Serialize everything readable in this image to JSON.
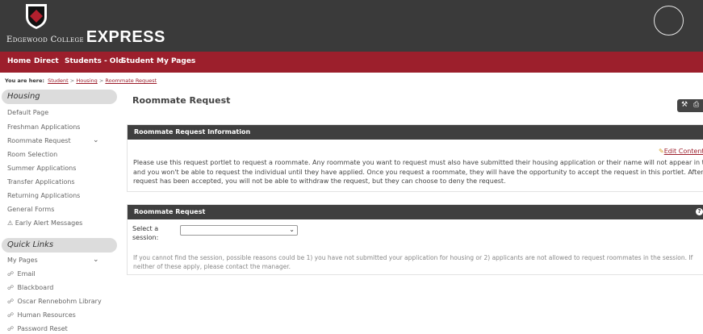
{
  "header": {
    "brand_small": "Edgewood College",
    "brand_big": "EXPRESS",
    "colors": {
      "top": "#3a3a3a",
      "nav": "#9c1f2c",
      "accent_text": "#9c1f2c"
    }
  },
  "nav": {
    "items": [
      "Home",
      "Direct",
      "Students - Old",
      "Student",
      "My Pages"
    ]
  },
  "breadcrumb": {
    "label": "You are here:",
    "items": [
      "Student",
      "Housing",
      "Roommate Request"
    ],
    "separator": ">"
  },
  "sidebar": {
    "section_title": "Housing",
    "items": [
      "Default Page",
      "Freshman Applications",
      "Roommate Request",
      "Room Selection",
      "Summer Applications",
      "Transfer Applications",
      "Returning Applications",
      "General Forms",
      "Early Alert Messages"
    ],
    "quick_links_title": "Quick Links",
    "my_pages_label": "My Pages",
    "links": [
      "Email",
      "Blackboard",
      "Oscar Rennebohm Library",
      "Human Resources",
      "Password Reset"
    ]
  },
  "main": {
    "title": "Roommate Request",
    "info_panel": {
      "title": "Roommate Request Information",
      "edit_label": "Edit Content",
      "lines": [
        "Please use this request portlet to request a roommate.  Any roommate you want to request must also have submitted their housing application or their name will not appear in the search",
        "and you won't be able to request the individual until they have applied.  Once you request a roommate, they will have the opportunity to accept the request in this portlet.  After your",
        "request has been accepted, you will not be able to withdraw the request, but they can choose to deny the request."
      ]
    },
    "request_panel": {
      "title": "Roommate Request",
      "select_label_1": "Select a",
      "select_label_2": "session:",
      "select_value": "",
      "note_lines": [
        "If you cannot find the session, possible reasons could be 1) you have not submitted your application for housing or 2) applicants are not allowed to request roommates in the session. If",
        "neither of these apply, please contact the manager."
      ]
    }
  },
  "icons": [
    "shield-logo-icon",
    "user-avatar-icon",
    "chevron-down-icon",
    "warning-icon",
    "link-icon",
    "wrench-icon",
    "printer-icon",
    "pencil-icon",
    "help-icon"
  ]
}
